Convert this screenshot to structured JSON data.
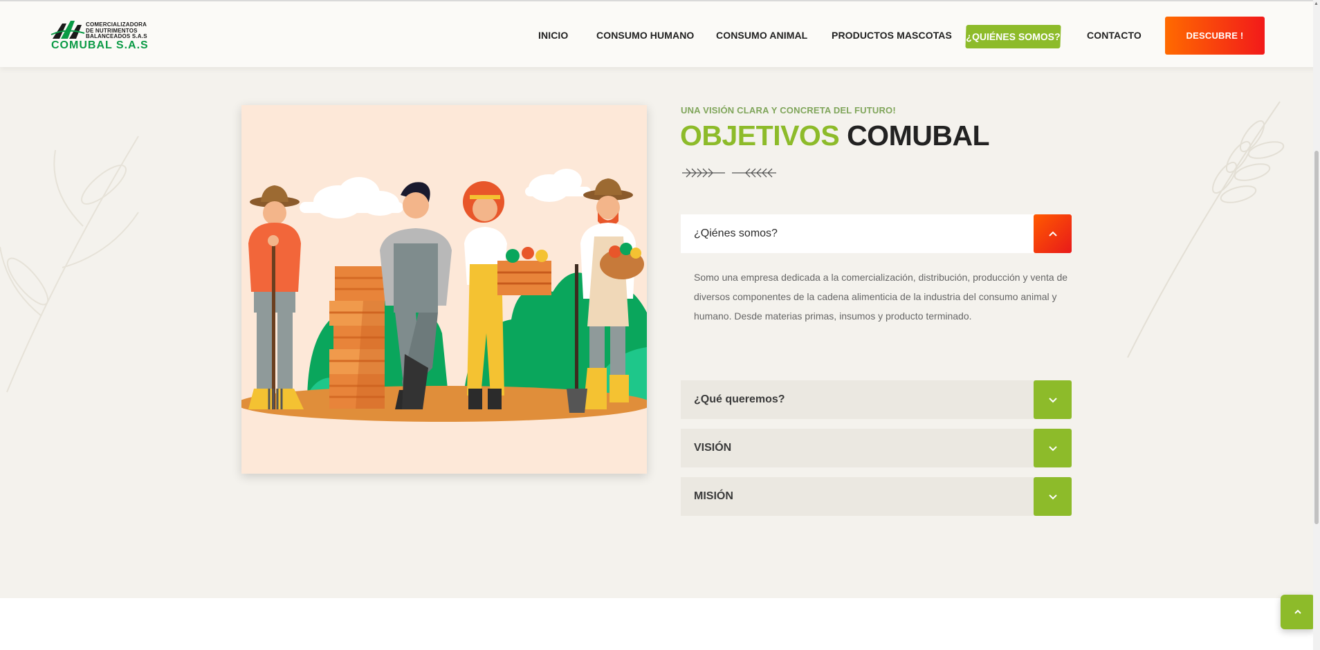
{
  "header": {
    "logo": {
      "small_lines": [
        "COMERCIALIZADORA",
        "DE NUTRIMENTOS",
        "BALANCEADOS S.A.S"
      ],
      "brand": "COMUBAL S.A.S"
    },
    "nav": [
      {
        "label": "INICIO"
      },
      {
        "label": "CONSUMO HUMANO"
      },
      {
        "label": "CONSUMO ANIMAL"
      },
      {
        "label": "PRODUCTOS MASCOTAS"
      },
      {
        "label": "¿QUIÉNES SOMOS?",
        "active": true
      },
      {
        "label": "CONTACTO"
      }
    ],
    "cta_label": "DESCUBRE !"
  },
  "section": {
    "eyebrow": "UNA VISIÓN CLARA Y CONCRETA DEL FUTURO!",
    "title_highlight": "OBJETIVOS",
    "title_rest": "COMUBAL",
    "accordion": [
      {
        "title": "¿Qiénes somos?",
        "open": true,
        "body": "Somo una empresa dedicada a la comercialización, distribución, producción y venta de diversos componentes de la cadena alimenticia de la industria del consumo animal y humano. Desde materias primas, insumos y producto terminado."
      },
      {
        "title": "¿Qué queremos?",
        "open": false
      },
      {
        "title": "VISIÓN",
        "open": false
      },
      {
        "title": "MISIÓN",
        "open": false
      }
    ]
  },
  "icons": {
    "accordion_open": "chevron-up-icon",
    "accordion_closed": "chevron-down-icon",
    "back_to_top": "chevron-up-icon",
    "divider": "wheat-arrows-icon"
  },
  "colors": {
    "brand_green": "#8dbb2a",
    "logo_green": "#0a9a45",
    "accent_orange": "#ff5a00",
    "accent_red": "#e81a1a",
    "background": "#f4f2ed"
  }
}
